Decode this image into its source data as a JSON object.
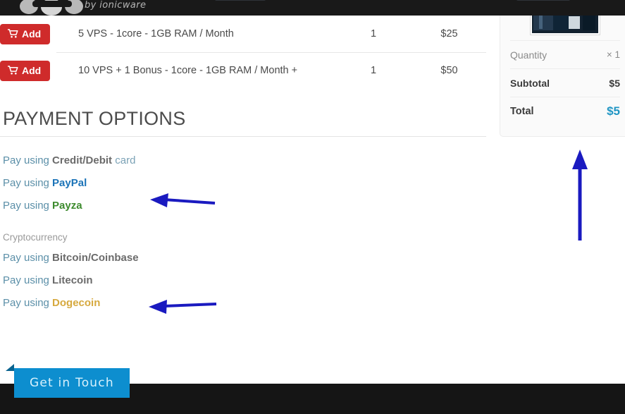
{
  "header": {
    "logo_tagline": "by ionicware"
  },
  "cart": {
    "rows": [
      {
        "add_label": "Add",
        "description": "5 VPS - 1core - 1GB RAM / Month",
        "quantity": "1",
        "price": "$25"
      },
      {
        "add_label": "Add",
        "description": "10 VPS + 1 Bonus - 1core - 1GB RAM / Month +",
        "quantity": "1",
        "price": "$50"
      }
    ]
  },
  "payment": {
    "title": "PAYMENT OPTIONS",
    "prefix": "Pay using ",
    "crypto_label": "Cryptocurrency",
    "options": [
      {
        "brand": "Credit/Debit",
        "tail": " card",
        "color": "#6b6b6b"
      },
      {
        "brand": "PayPal",
        "tail": "",
        "color": "#1c74b8"
      },
      {
        "brand": "Payza",
        "tail": "",
        "color": "#3d8b2e"
      }
    ],
    "crypto_options": [
      {
        "brand": "Bitcoin/Coinbase",
        "tail": "",
        "color": "#6b6b6b"
      },
      {
        "brand": "Litecoin",
        "tail": "",
        "color": "#6b6b6b"
      },
      {
        "brand": "Dogecoin",
        "tail": "",
        "color": "#d6a93f"
      }
    ]
  },
  "summary": {
    "quantity_label": "Quantity",
    "quantity_value": "× 1",
    "subtotal_label": "Subtotal",
    "subtotal_value": "$5",
    "total_label": "Total",
    "total_value": "$5"
  },
  "cta": {
    "get_in_touch": "Get in Touch"
  },
  "annotations": {
    "arrow_color": "#1a1ac0"
  }
}
